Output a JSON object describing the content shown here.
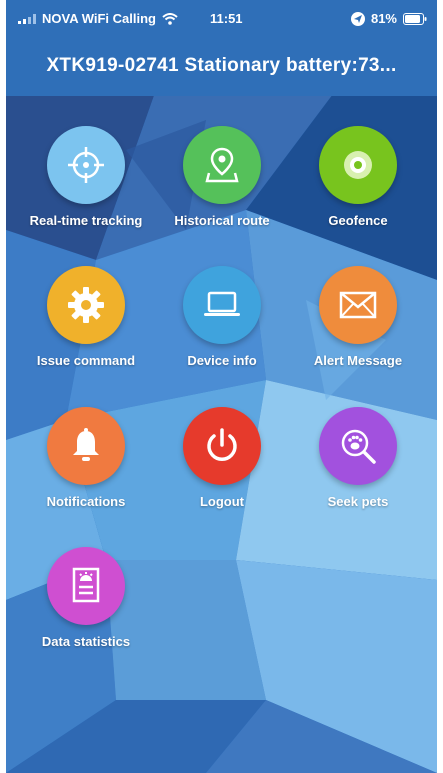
{
  "status": {
    "carrier": "NOVA WiFi Calling",
    "time": "11:51",
    "battery": "81%",
    "icons": [
      "signal-icon",
      "wifi-icon",
      "location-arrow-icon",
      "battery-icon"
    ]
  },
  "header": {
    "title": "XTK919-02741 Stationary battery:73..."
  },
  "menu": [
    {
      "label": "Real-time tracking",
      "icon": "crosshair-icon",
      "color": "#7cc4ef"
    },
    {
      "label": "Historical route",
      "icon": "map-pin-icon",
      "color": "#55c15a"
    },
    {
      "label": "Geofence",
      "icon": "target-icon",
      "color": "#78c41e"
    },
    {
      "label": "Issue command",
      "icon": "gear-icon",
      "color": "#f0b12b"
    },
    {
      "label": "Device info",
      "icon": "laptop-icon",
      "color": "#3fa3dd"
    },
    {
      "label": "Alert Message",
      "icon": "envelope-icon",
      "color": "#ef8c3c"
    },
    {
      "label": "Notifications",
      "icon": "bell-icon",
      "color": "#f07a40"
    },
    {
      "label": "Logout",
      "icon": "power-icon",
      "color": "#e63a2c"
    },
    {
      "label": "Seek pets",
      "icon": "paw-search-icon",
      "color": "#a251de"
    },
    {
      "label": "Data statistics",
      "icon": "report-icon",
      "color": "#cf4fd1"
    }
  ]
}
